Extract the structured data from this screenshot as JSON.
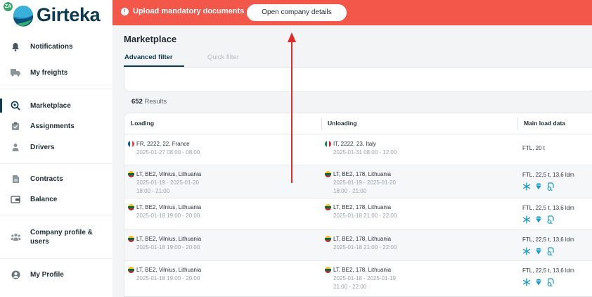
{
  "brand": {
    "name": "Girteka",
    "ext_badge": "ZA"
  },
  "sidebar": {
    "items": [
      {
        "label": "Notifications",
        "icon": "bell-icon"
      },
      {
        "label": "My freights",
        "icon": "truck-icon"
      },
      {
        "label": "Marketplace",
        "icon": "marketplace-search-icon",
        "active": true
      },
      {
        "label": "Assignments",
        "icon": "assignments-icon"
      },
      {
        "label": "Drivers",
        "icon": "driver-icon"
      },
      {
        "label": "Contracts",
        "icon": "document-icon"
      },
      {
        "label": "Balance",
        "icon": "wallet-icon"
      },
      {
        "label": "Company profile & users",
        "icon": "users-icon"
      },
      {
        "label": "My Profile",
        "icon": "profile-icon"
      }
    ]
  },
  "banner": {
    "message": "Upload mandatory documents",
    "button_label": "Open company details",
    "warning_glyph": "!",
    "color": "#f2574a"
  },
  "main": {
    "title": "Marketplace",
    "tabs": [
      {
        "label": "Advanced filter",
        "active": true
      },
      {
        "label": "Quick filter",
        "active": false
      }
    ],
    "results_count": "652",
    "results_label": "Results",
    "columns": [
      "Loading",
      "Unloading",
      "Main load data"
    ],
    "rows": [
      {
        "loading_flag": "fr",
        "loading": "FR, 2222, 22, France",
        "loading_dates": [
          "2025-01-27 08:00 - 08:00"
        ],
        "unloading_flag": "it",
        "unloading": "IT, 2222, 23, Italy",
        "unloading_dates": [
          "2025-01-31 08:00 - 12:00"
        ],
        "load": "FTL, 20 t",
        "icons": false
      },
      {
        "loading_flag": "lt",
        "loading": "LT, BE2, Vilnius, Lithuania",
        "loading_dates": [
          "2025-01-19 - 2025-01-20",
          "18:00 - 21:00"
        ],
        "unloading_flag": "lt",
        "unloading": "LT, BE2, 178, Lithuania",
        "unloading_dates": [
          "2025-01-19 - 2025-01-20",
          "18:00 - 21:00"
        ],
        "load": "FTL, 22,5 t, 13,6 ldm",
        "icons": true
      },
      {
        "loading_flag": "lt",
        "loading": "LT, BE2, Vilnius, Lithuania",
        "loading_dates": [
          "2025-01-18 19:00 - 20:00"
        ],
        "unloading_flag": "lt",
        "unloading": "LT, BE2, 178, Lithuania",
        "unloading_dates": [
          "2025-01-18 21:00 - 22:00"
        ],
        "load": "FTL, 22,5 t, 13,6 ldm",
        "icons": true
      },
      {
        "loading_flag": "lt",
        "loading": "LT, BE2, Vilnius, Lithuania",
        "loading_dates": [
          "2025-01-18 19:00 - 20:00"
        ],
        "unloading_flag": "lt",
        "unloading": "LT, BE2, 178, Lithuania",
        "unloading_dates": [
          "2025-01-18 21:00 - 22:00"
        ],
        "load": "FTL, 22,5 t, 13,6 ldm",
        "icons": true
      },
      {
        "loading_flag": "lt",
        "loading": "LT, BE2, Vilnius, Lithuania",
        "loading_dates": [
          "2025-01-18 19:00 - 20:00"
        ],
        "unloading_flag": "lt",
        "unloading": "LT, BE2, 178, Lithuania",
        "unloading_dates": [
          "2025-01-18 - 2025-01-19",
          "21:00 - 22:00"
        ],
        "load": "FTL, 22,5 t, 13,6 ldm",
        "icons": true
      }
    ],
    "load_icons": [
      "snowflake-icon",
      "diamond-icon",
      "document-sign-icon"
    ],
    "accent_color": "#0e3a4f",
    "icon_color": "#1a9bc7"
  },
  "annotation": {
    "type": "red-arrow",
    "color": "#e02b2b"
  }
}
